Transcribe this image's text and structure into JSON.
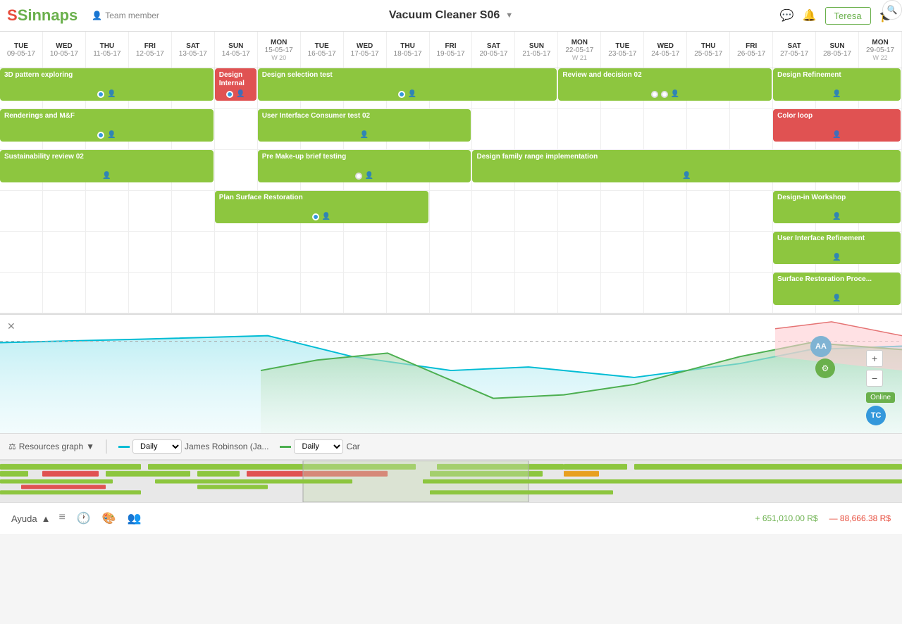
{
  "header": {
    "logo": "Sinnaps",
    "project_name": "Vacuum Cleaner S06",
    "team_member_label": "Team member",
    "user_button": "Teresa"
  },
  "columns": [
    {
      "day": "TUE",
      "date": "09-05-17"
    },
    {
      "day": "WED",
      "date": "10-05-17"
    },
    {
      "day": "THU",
      "date": "11-05-17"
    },
    {
      "day": "FRI",
      "date": "12-05-17"
    },
    {
      "day": "SAT",
      "date": "13-05-17"
    },
    {
      "day": "SUN",
      "date": "14-05-17"
    },
    {
      "day": "MON",
      "date": "15-05-17",
      "week": "W 20"
    },
    {
      "day": "TUE",
      "date": "16-05-17"
    },
    {
      "day": "WED",
      "date": "17-05-17"
    },
    {
      "day": "THU",
      "date": "18-05-17"
    },
    {
      "day": "FRI",
      "date": "19-05-17"
    },
    {
      "day": "SAT",
      "date": "20-05-17"
    },
    {
      "day": "SUN",
      "date": "21-05-17"
    },
    {
      "day": "MON",
      "date": "22-05-17",
      "week": "W 21"
    },
    {
      "day": "TUE",
      "date": "23-05-17"
    },
    {
      "day": "WED",
      "date": "24-05-17"
    },
    {
      "day": "THU",
      "date": "25-05-17"
    },
    {
      "day": "FRI",
      "date": "26-05-17"
    },
    {
      "day": "SAT",
      "date": "27-05-17"
    },
    {
      "day": "SUN",
      "date": "28-05-17"
    },
    {
      "day": "MON",
      "date": "29-05-17",
      "week": "W 22"
    }
  ],
  "tasks": [
    {
      "name": "3D pattern exploring",
      "color": "green",
      "col_start": 0,
      "col_end": 4,
      "row": 0,
      "dot": "blue"
    },
    {
      "name": "Design Internal",
      "color": "red",
      "col_start": 5,
      "col_end": 5,
      "row": 0,
      "dot": "blue"
    },
    {
      "name": "Design selection test",
      "color": "green",
      "col_start": 6,
      "col_end": 12,
      "row": 0,
      "dot": "blue"
    },
    {
      "name": "Review and decision 02",
      "color": "green",
      "col_start": 13,
      "col_end": 17,
      "row": 0,
      "dot": "double"
    },
    {
      "name": "Design Refinement",
      "color": "green",
      "col_start": 18,
      "col_end": 20,
      "row": 0
    },
    {
      "name": "Renderings and M&F",
      "color": "green",
      "col_start": 0,
      "col_end": 4,
      "row": 1,
      "dot": "blue"
    },
    {
      "name": "User Interface Consumer test 02",
      "color": "green",
      "col_start": 6,
      "col_end": 10,
      "row": 1
    },
    {
      "name": "Color loop",
      "color": "red",
      "col_start": 18,
      "col_end": 20,
      "row": 1
    },
    {
      "name": "Sustainability review 02",
      "color": "green",
      "col_start": 0,
      "col_end": 4,
      "row": 2
    },
    {
      "name": "Pre Make-up brief testing",
      "color": "green",
      "col_start": 6,
      "col_end": 10,
      "row": 2,
      "dot": "white"
    },
    {
      "name": "Design family range implementation",
      "color": "green",
      "col_start": 11,
      "col_end": 20,
      "row": 2
    },
    {
      "name": "Plan Surface Restoration",
      "color": "green",
      "col_start": 5,
      "col_end": 9,
      "row": 3,
      "dot": "blue"
    },
    {
      "name": "Design-in Workshop",
      "color": "green",
      "col_start": 18,
      "col_end": 20,
      "row": 3
    },
    {
      "name": "User Interface Refinement",
      "color": "green",
      "col_start": 18,
      "col_end": 20,
      "row": 4
    },
    {
      "name": "Surface Restoration Proce...",
      "color": "green",
      "col_start": 18,
      "col_end": 20,
      "row": 5
    }
  ],
  "resource_controls": {
    "label": "Resources graph",
    "item1_color": "#00bcd4",
    "item1_freq": "Daily",
    "item1_name": "James Robinson (Ja...",
    "item2_color": "#4caf50",
    "item2_freq": "Daily",
    "item2_name": "Car"
  },
  "bottom": {
    "help": "Ayuda",
    "cost_plus": "+ 651,010.00 R$",
    "cost_minus": "— 88,666.38 R$"
  },
  "zoom": {
    "plus": "+",
    "minus": "−",
    "online": "Online",
    "tc": "TC"
  }
}
